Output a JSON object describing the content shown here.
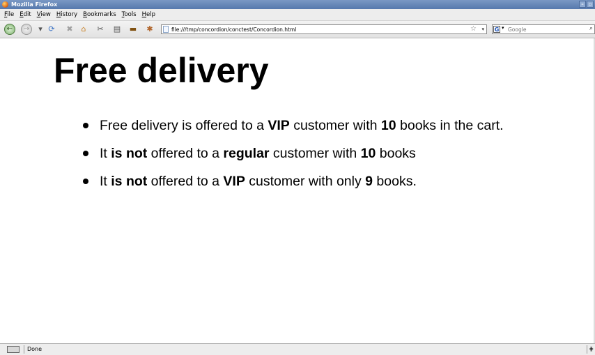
{
  "window": {
    "title": "Mozilla Firefox"
  },
  "menu": [
    "File",
    "Edit",
    "View",
    "History",
    "Bookmarks",
    "Tools",
    "Help"
  ],
  "navbar": {
    "url": "file:///tmp/concordion/conctest/Concordion.html",
    "search_placeholder": "Google"
  },
  "page": {
    "heading": "Free delivery",
    "items": [
      [
        {
          "t": "Free delivery is offered to a ",
          "b": false
        },
        {
          "t": "VIP",
          "b": true
        },
        {
          "t": " customer with ",
          "b": false
        },
        {
          "t": "10",
          "b": true
        },
        {
          "t": " books in the cart.",
          "b": false
        }
      ],
      [
        {
          "t": "It ",
          "b": false
        },
        {
          "t": "is not",
          "b": true
        },
        {
          "t": " offered to a ",
          "b": false
        },
        {
          "t": "regular",
          "b": true
        },
        {
          "t": " customer with ",
          "b": false
        },
        {
          "t": "10",
          "b": true
        },
        {
          "t": " books",
          "b": false
        }
      ],
      [
        {
          "t": "It ",
          "b": false
        },
        {
          "t": "is not",
          "b": true
        },
        {
          "t": " offered to a ",
          "b": false
        },
        {
          "t": "VIP",
          "b": true
        },
        {
          "t": " customer with only ",
          "b": false
        },
        {
          "t": "9",
          "b": true
        },
        {
          "t": " books.",
          "b": false
        }
      ]
    ]
  },
  "status": {
    "text": "Done"
  }
}
